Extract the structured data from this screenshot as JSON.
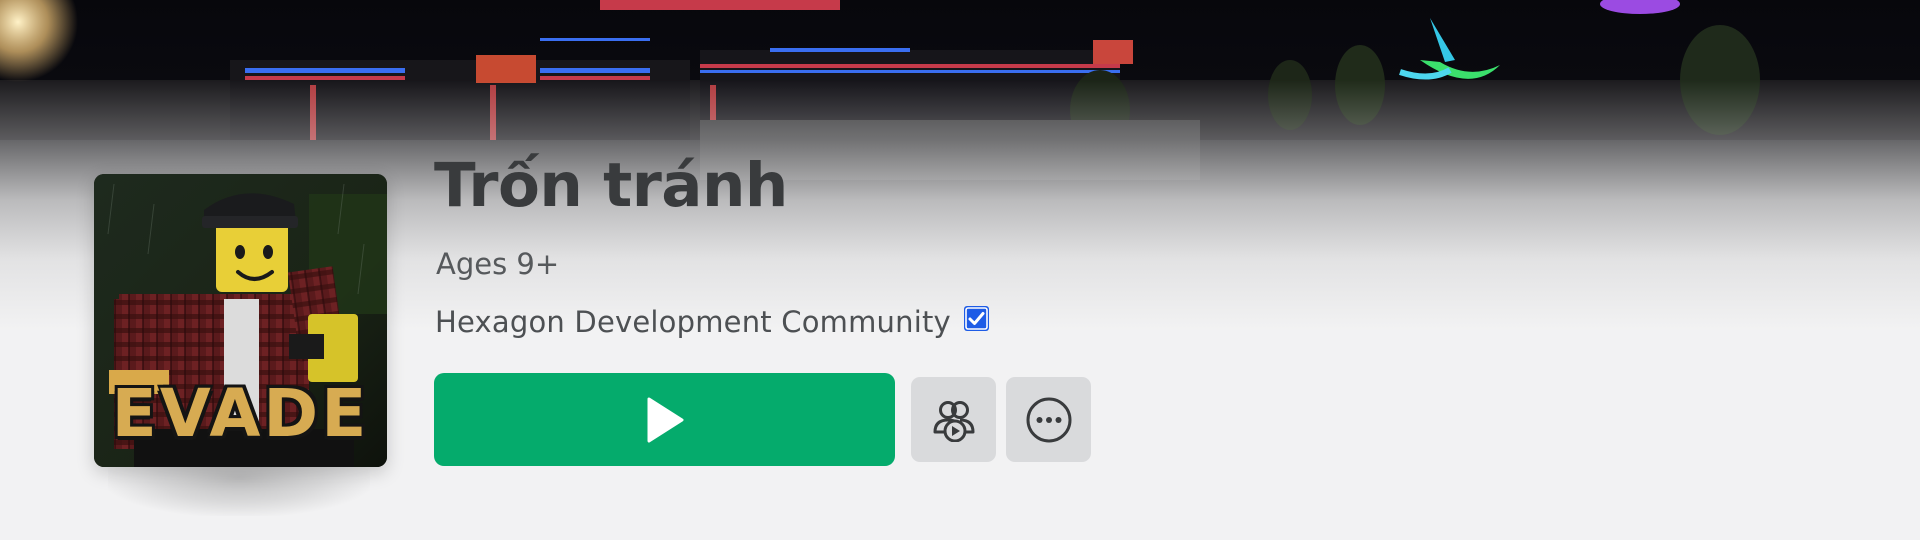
{
  "game": {
    "title": "Trốn tránh",
    "age_rating": "Ages 9+",
    "creator": "Hexagon Development Community",
    "creator_verified": true,
    "thumbnail_text": "EVADE"
  },
  "actions": {
    "play": {
      "icon": "play-icon",
      "color": "#05ab6c"
    },
    "party": {
      "icon": "party-icon"
    },
    "more": {
      "icon": "more-options-icon"
    }
  },
  "colors": {
    "verified_badge": "#1e5ce6",
    "page_background": "#f2f2f3",
    "title_text": "#393b3d"
  }
}
